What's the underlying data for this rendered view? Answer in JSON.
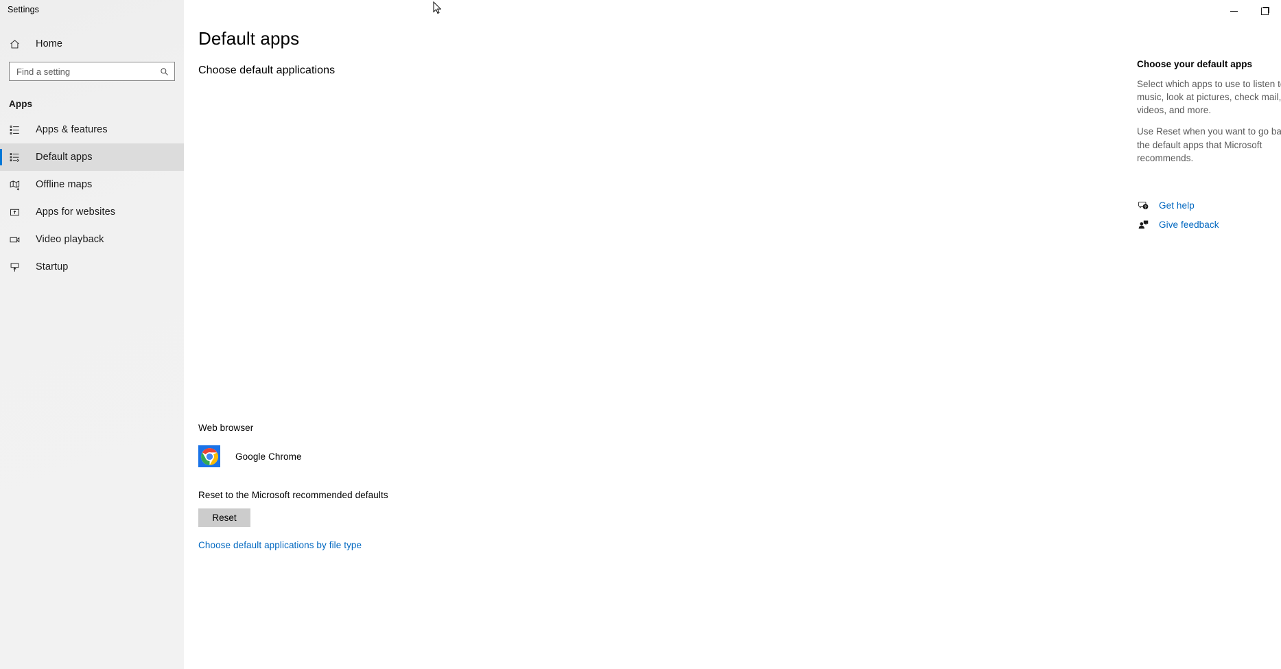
{
  "window": {
    "title": "Settings",
    "controls": {
      "minimize": "Minimize",
      "restore": "Restore"
    }
  },
  "sidebar": {
    "home": {
      "label": "Home",
      "icon": "home-icon"
    },
    "search": {
      "placeholder": "Find a setting",
      "value": "",
      "icon": "search-icon"
    },
    "group_header": "Apps",
    "items": [
      {
        "label": "Apps & features",
        "icon": "list-icon",
        "selected": false
      },
      {
        "label": "Default apps",
        "icon": "default-apps-icon",
        "selected": true
      },
      {
        "label": "Offline maps",
        "icon": "map-download-icon",
        "selected": false
      },
      {
        "label": "Apps for websites",
        "icon": "app-website-icon",
        "selected": false
      },
      {
        "label": "Video playback",
        "icon": "video-camera-icon",
        "selected": false
      },
      {
        "label": "Startup",
        "icon": "startup-icon",
        "selected": false
      }
    ],
    "accent_color": "#0078d7"
  },
  "main": {
    "title": "Default apps",
    "subtitle": "Choose default applications",
    "web_browser": {
      "section_label": "Web browser",
      "app_name": "Google Chrome",
      "icon": "google-chrome-icon",
      "tile_color": "#1a73e8"
    },
    "reset": {
      "label": "Reset to the Microsoft recommended defaults",
      "button_label": "Reset"
    },
    "file_type_link": "Choose default applications by file type"
  },
  "aside": {
    "title": "Choose your default apps",
    "paragraphs": [
      "Select which apps to use to listen to music, look at pictures, check mail, watch videos, and more.",
      "Use Reset when you want to go back to the default apps that Microsoft recommends."
    ],
    "links": [
      {
        "label": "Get help",
        "icon": "help-bubble-icon"
      },
      {
        "label": "Give feedback",
        "icon": "feedback-person-icon"
      }
    ],
    "link_color": "#0067c0"
  }
}
